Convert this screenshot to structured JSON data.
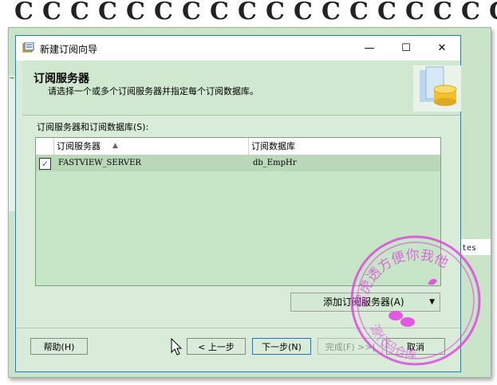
{
  "window": {
    "title": "新建订阅向导",
    "controls": {
      "minimize": "—",
      "maximize": "☐",
      "close": "✕"
    }
  },
  "header": {
    "title": "订阅服务器",
    "subtitle": "请选择一个或多个订阅服务器并指定每个订阅数据库。",
    "art_icon": "database-icon"
  },
  "list": {
    "label": "订阅服务器和订阅数据库(S):",
    "columns": [
      "订阅服务器",
      "订阅数据库"
    ],
    "sort_indicator": "▲",
    "rows": [
      {
        "checked": true,
        "checkmark": "✓",
        "server": "FASTVIEW_SERVER",
        "database": "db_EmpHr"
      }
    ]
  },
  "buttons": {
    "add_subscriber": "添加订阅服务器(A)",
    "add_arrow": "▼",
    "help": "帮助(H)",
    "back": "< 上一步",
    "next": "下一步(N)",
    "finish": "完成(F) >>|",
    "cancel": "取消"
  },
  "background": {
    "partial_text": "tes",
    "left_glyph": "~"
  },
  "stamp": {
    "text": "雷虎透方便你我他",
    "text2": "源代码仓库"
  },
  "colors": {
    "accent": "#1a7fd4",
    "dialog_bg": "#d9ecd9",
    "stamp": "#e040e0"
  }
}
